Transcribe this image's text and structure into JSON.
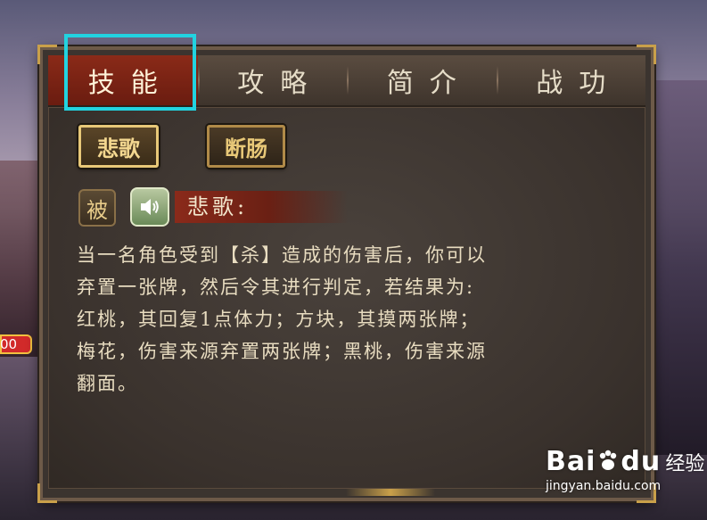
{
  "side_badge": {
    "text": "00"
  },
  "tabs": [
    {
      "label": "技能",
      "active": true
    },
    {
      "label": "攻略",
      "active": false
    },
    {
      "label": "简介",
      "active": false
    },
    {
      "label": "战功",
      "active": false
    }
  ],
  "skills": [
    {
      "label": "悲歌",
      "selected": true
    },
    {
      "label": "断肠",
      "selected": false
    }
  ],
  "skill_detail": {
    "type_badge": "被",
    "speaker_icon": "speaker-icon",
    "title": "悲歌:",
    "description_lines": [
      "当一名角色受到【杀】造成的伤害后，你可以",
      "弃置一张牌，然后令其进行判定，若结果为:",
      "红桃，其回复1点体力；方块，其摸两张牌；",
      "梅花，伤害来源弃置两张牌；黑桃，伤害来源",
      "翻面。"
    ]
  },
  "watermark": {
    "brand": "Bai",
    "brand2": "du",
    "sub": "经验",
    "url": "jingyan.baidu.com"
  },
  "colors": {
    "active_tab": "#8a2a18",
    "highlight_box": "#22d3e0",
    "gold": "#e8c878"
  }
}
